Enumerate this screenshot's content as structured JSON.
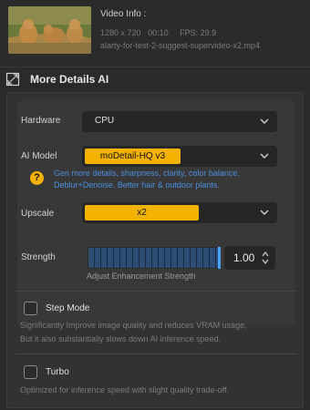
{
  "video_info": {
    "title": "Video Info :",
    "resolution": "1280 x 720",
    "duration": "00:10",
    "fps": "FPS: 29.9",
    "filename": "alarty-for-test-2-suggest-supervideo-x2.mp4"
  },
  "section": {
    "title": "More Details AI",
    "icon": "expand-icon"
  },
  "settings": {
    "hardware": {
      "label": "Hardware",
      "value": "CPU"
    },
    "ai_model": {
      "label": "AI Model",
      "value": "moDetail-HQ  v3",
      "hint_line1": "Gen more details, sharpness, clarity, color balance.",
      "hint_line2": "Deblur+Denoise. Better hair & outdoor plants.",
      "hint_icon": "?"
    },
    "upscale": {
      "label": "Upscale",
      "value": "x2"
    },
    "strength": {
      "label": "Strength",
      "value": "1.00",
      "level": 1.0,
      "note": "Adjust Enhancement Strength"
    }
  },
  "options": {
    "step_mode": {
      "label": "Step Mode",
      "checked": false,
      "desc_line1": "Significantly Improve image quality and reduces VRAM usage,",
      "desc_line2": "But it also substantially slows down AI inference speed."
    },
    "turbo": {
      "label": "Turbo",
      "checked": false,
      "desc": "Optimized for inference speed with slight quality trade-off."
    }
  },
  "colors": {
    "accent": "#f3b200",
    "hint_text": "#4a8fe0",
    "strength_fill": "#2d4d73"
  }
}
